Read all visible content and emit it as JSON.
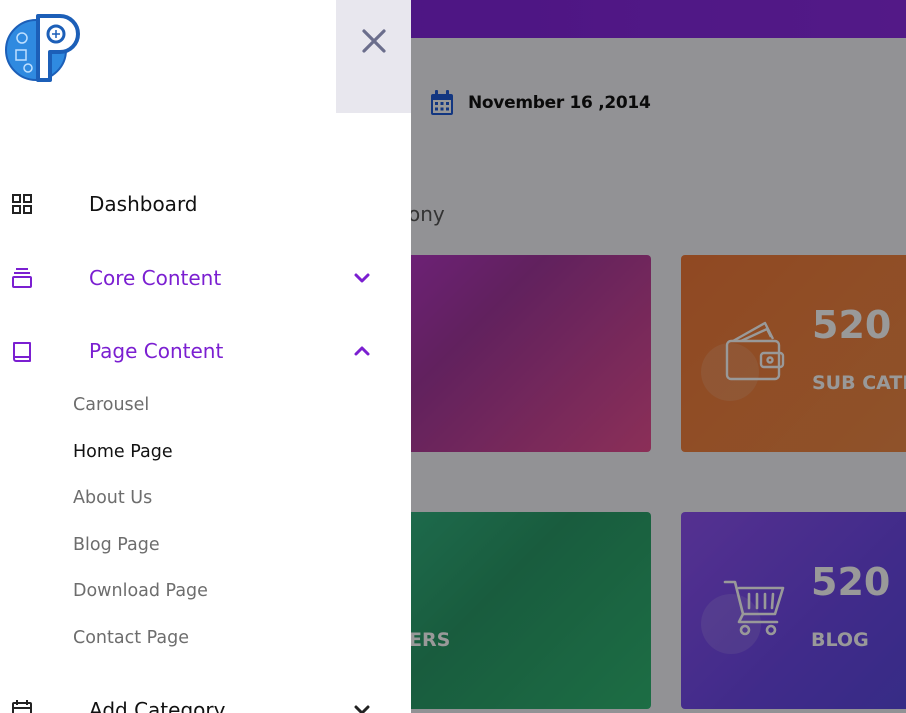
{
  "dashboard": {
    "date": "November 16 ,2014",
    "greeting_fragment": "Rony",
    "cards": [
      {
        "number": "",
        "label": ""
      },
      {
        "number": "520",
        "label": "SUB CATE"
      },
      {
        "number": "",
        "label": "ERS"
      },
      {
        "number": "520",
        "label": "BLOG"
      }
    ]
  },
  "sidebar": {
    "items": [
      {
        "label": "Dashboard",
        "icon": "grid-icon",
        "state": "default"
      },
      {
        "label": "Core Content",
        "icon": "stack-icon",
        "state": "collapsed"
      },
      {
        "label": "Page Content",
        "icon": "book-icon",
        "state": "expanded"
      },
      {
        "label": "Add Category",
        "icon": "calendar-icon",
        "state": "collapsed"
      }
    ],
    "page_content_subitems": [
      {
        "label": "Carousel"
      },
      {
        "label": "Home Page"
      },
      {
        "label": "About Us"
      },
      {
        "label": "Blog Page"
      },
      {
        "label": "Download Page"
      },
      {
        "label": "Contact Page"
      }
    ]
  },
  "colors": {
    "accent": "#7b1fd1",
    "topbar": "#8a2be2",
    "close_bg": "#e8e7ee"
  }
}
